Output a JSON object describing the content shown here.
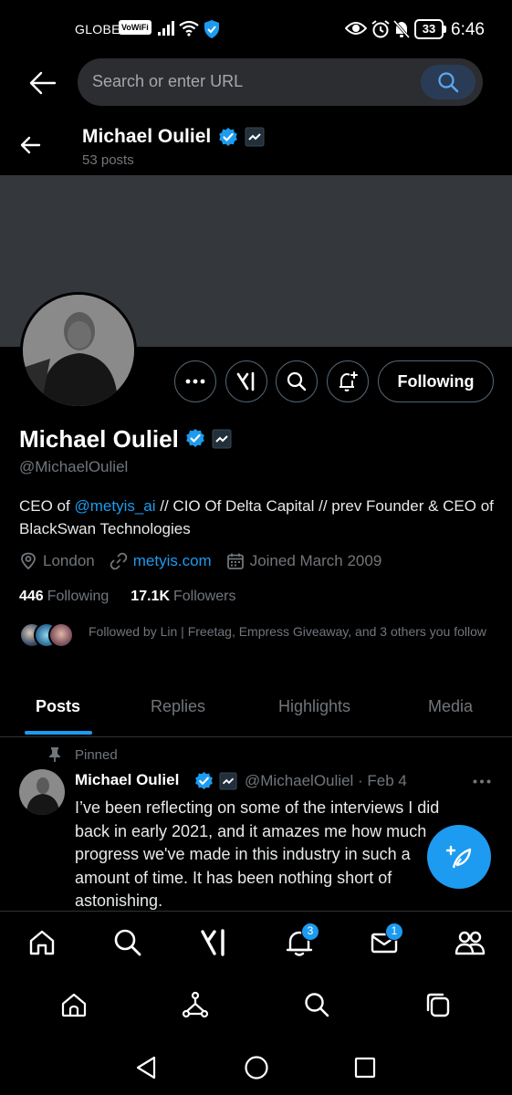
{
  "status_bar": {
    "carrier": "GLOBE",
    "vowifi": "VoWiFi",
    "battery": "33",
    "time": "6:46"
  },
  "browser": {
    "url_placeholder": "Search or enter URL"
  },
  "header": {
    "name": "Michael Ouliel",
    "posts_count": "53 posts"
  },
  "profile": {
    "name": "Michael Ouliel",
    "handle": "@MichaelOuliel",
    "bio_prefix": "CEO of ",
    "bio_mention": "@metyis_ai",
    "bio_suffix": " // CIO Of Delta Capital // prev Founder & CEO of BlackSwan Technologies",
    "location": "London",
    "website": "metyis.com",
    "joined": "Joined March 2009",
    "following_count": "446",
    "following_label": "Following",
    "followers_count": "17.1K",
    "followers_label": "Followers",
    "followed_by": "Followed by Lin | Freetag, Empress Giveaway, and 3 others you follow",
    "following_button": "Following"
  },
  "tabs": [
    {
      "label": "Posts",
      "active": true
    },
    {
      "label": "Replies",
      "active": false
    },
    {
      "label": "Highlights",
      "active": false
    },
    {
      "label": "Media",
      "active": false
    }
  ],
  "post": {
    "pinned_label": "Pinned",
    "author_name": "Michael Ouliel",
    "author_handle_date": "@MichaelOuliel · Feb 4",
    "text": "I’ve been reflecting on some of the interviews I did back in early 2021, and it amazes me how much progress we've made in this industry in such a amount of time. It has been nothing short of astonishing."
  },
  "bottom_nav": {
    "notifications_badge": "3",
    "messages_badge": "1"
  },
  "colors": {
    "accent": "#1d9bf0",
    "background": "#000000",
    "banner": "#34373b",
    "muted_text": "#71767b"
  }
}
